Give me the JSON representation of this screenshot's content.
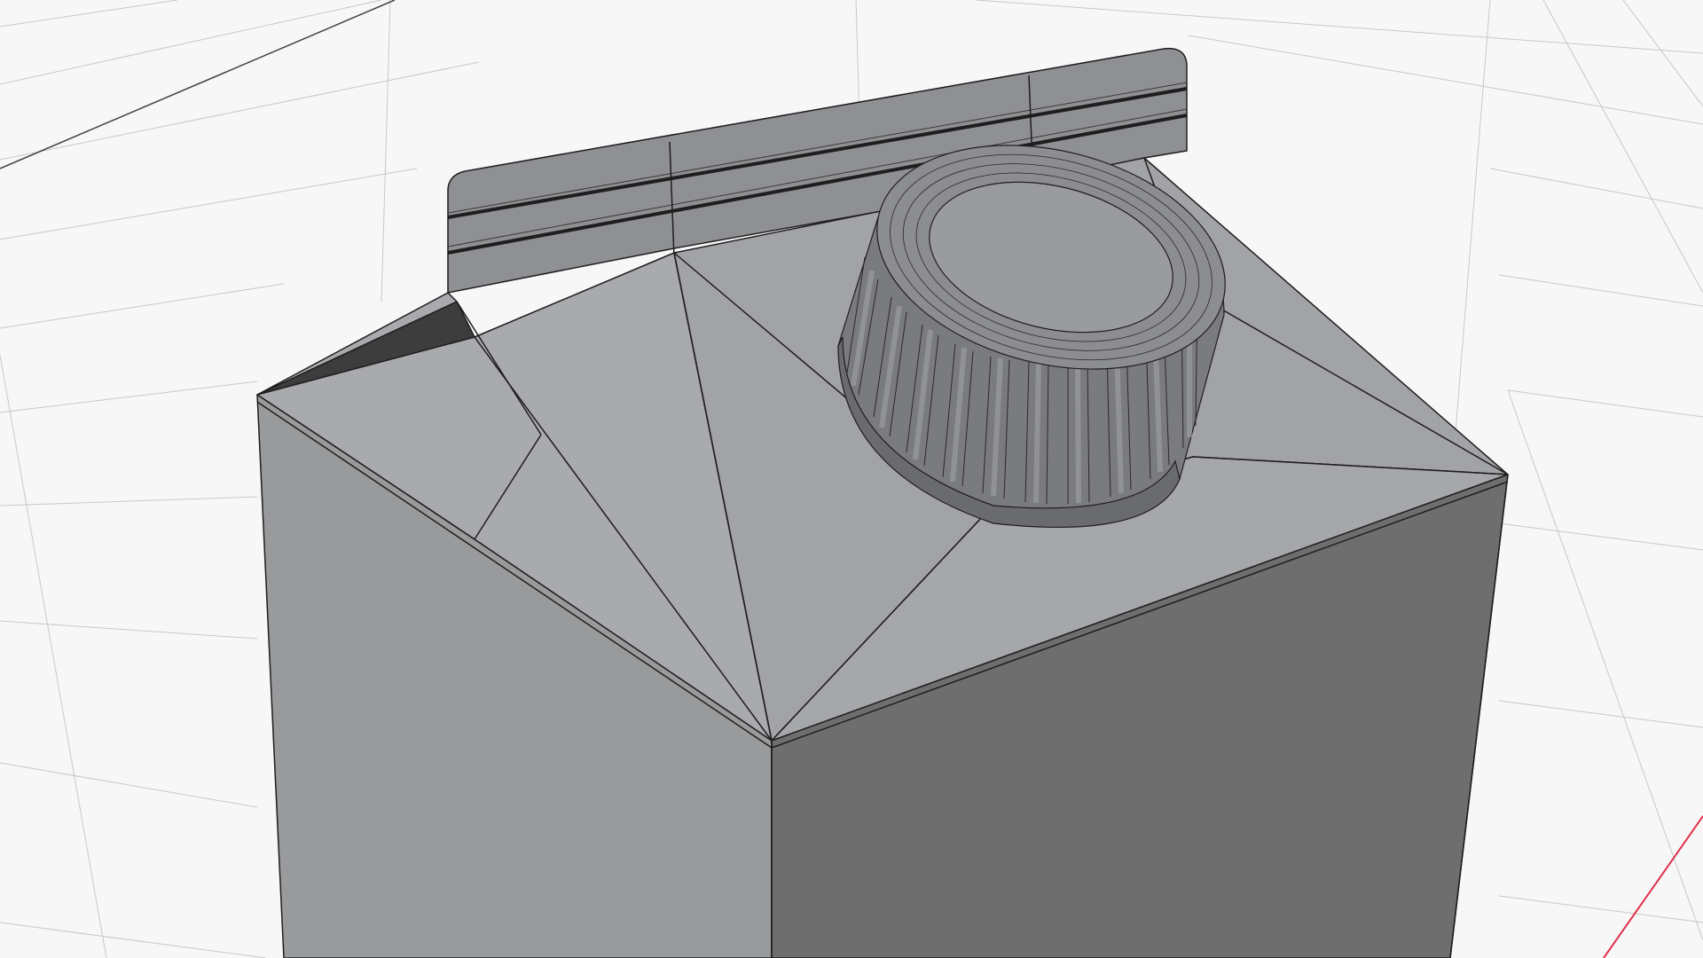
{
  "viewport": {
    "background_color": "#f7f7f7",
    "grid_color": "#c8c8c8",
    "axis_x_color": "#e0314b"
  },
  "model": {
    "name": "milk-carton-with-screw-cap",
    "shading": "solid-gray-with-wireframe",
    "colors": {
      "front_face": "#999a9c",
      "right_face": "#6e6e6e",
      "roof_left": "#a9aaad",
      "roof_mid": "#a2a3a6",
      "roof_right": "#a6a7aa",
      "fin": "#8f9093",
      "cap_top": "#9a9b9e",
      "cap_side": "#7a7b7e",
      "wire": "#1e1e1e"
    }
  }
}
